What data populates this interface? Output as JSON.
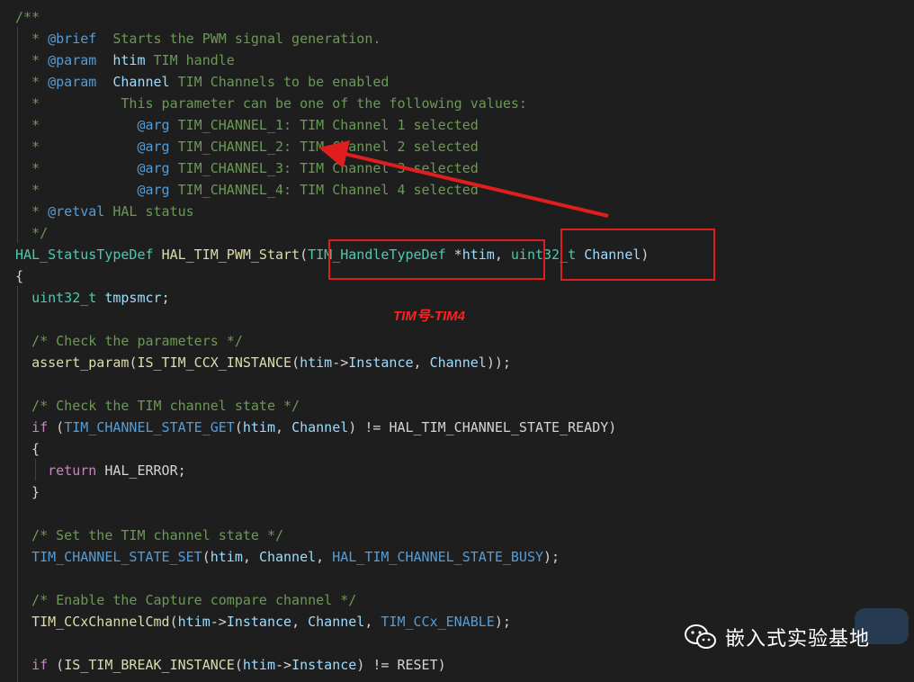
{
  "colors": {
    "background": "#1e1e1e",
    "comment": "#6a9955",
    "doc_keyword": "#569cd6",
    "plain": "#d4d4d4",
    "function": "#dcdcaa",
    "type": "#4ec9b0",
    "variable": "#9cdcfe",
    "macro": "#4fc1ff",
    "control_keyword": "#c586c0",
    "annotation_red": "#e01e1e"
  },
  "code_lines": [
    [
      {
        "t": "/**",
        "c": "c"
      }
    ],
    [
      {
        "t": "  * ",
        "c": "c"
      },
      {
        "t": "@brief",
        "c": "dk"
      },
      {
        "t": "  Starts the PWM signal generation.",
        "c": "c"
      }
    ],
    [
      {
        "t": "  * ",
        "c": "c"
      },
      {
        "t": "@param",
        "c": "dk"
      },
      {
        "t": "  ",
        "c": "c"
      },
      {
        "t": "htim",
        "c": "v"
      },
      {
        "t": " TIM handle",
        "c": "c"
      }
    ],
    [
      {
        "t": "  * ",
        "c": "c"
      },
      {
        "t": "@param",
        "c": "dk"
      },
      {
        "t": "  ",
        "c": "c"
      },
      {
        "t": "Channel",
        "c": "v"
      },
      {
        "t": " TIM Channels to be enabled",
        "c": "c"
      }
    ],
    [
      {
        "t": "  *          This parameter can be one of the following values:",
        "c": "c"
      }
    ],
    [
      {
        "t": "  *            ",
        "c": "c"
      },
      {
        "t": "@arg",
        "c": "dk"
      },
      {
        "t": " TIM_CHANNEL_1: TIM Channel 1 selected",
        "c": "c"
      }
    ],
    [
      {
        "t": "  *            ",
        "c": "c"
      },
      {
        "t": "@arg",
        "c": "dk"
      },
      {
        "t": " TIM_CHANNEL_2: TIM Channel 2 selected",
        "c": "c"
      }
    ],
    [
      {
        "t": "  *            ",
        "c": "c"
      },
      {
        "t": "@arg",
        "c": "dk"
      },
      {
        "t": " TIM_CHANNEL_3: TIM Channel 3 selected",
        "c": "c"
      }
    ],
    [
      {
        "t": "  *            ",
        "c": "c"
      },
      {
        "t": "@arg",
        "c": "dk"
      },
      {
        "t": " TIM_CHANNEL_4: TIM Channel 4 selected",
        "c": "c"
      }
    ],
    [
      {
        "t": "  * ",
        "c": "c"
      },
      {
        "t": "@retval",
        "c": "dk"
      },
      {
        "t": " HAL status",
        "c": "c"
      }
    ],
    [
      {
        "t": "  */",
        "c": "c"
      }
    ],
    [
      {
        "t": "HAL_StatusTypeDef",
        "c": "t"
      },
      {
        "t": " ",
        "c": "p"
      },
      {
        "t": "HAL_TIM_PWM_Start",
        "c": "f"
      },
      {
        "t": "(",
        "c": "p"
      },
      {
        "t": "TIM_HandleTypeDef",
        "c": "t"
      },
      {
        "t": " *",
        "c": "p"
      },
      {
        "t": "htim",
        "c": "v"
      },
      {
        "t": ", ",
        "c": "p"
      },
      {
        "t": "uint32_t",
        "c": "t"
      },
      {
        "t": " ",
        "c": "p"
      },
      {
        "t": "Channel",
        "c": "v"
      },
      {
        "t": ")",
        "c": "p"
      }
    ],
    [
      {
        "t": "{",
        "c": "p"
      }
    ],
    [
      {
        "t": "  ",
        "c": "p"
      },
      {
        "t": "uint32_t",
        "c": "t"
      },
      {
        "t": " ",
        "c": "p"
      },
      {
        "t": "tmpsmcr",
        "c": "v"
      },
      {
        "t": ";",
        "c": "p"
      }
    ],
    [],
    [
      {
        "t": "  /* Check the parameters */",
        "c": "c"
      }
    ],
    [
      {
        "t": "  ",
        "c": "p"
      },
      {
        "t": "assert_param",
        "c": "f"
      },
      {
        "t": "(",
        "c": "p"
      },
      {
        "t": "IS_TIM_CCX_INSTANCE",
        "c": "f"
      },
      {
        "t": "(",
        "c": "p"
      },
      {
        "t": "htim",
        "c": "v"
      },
      {
        "t": "->",
        "c": "p"
      },
      {
        "t": "Instance",
        "c": "v"
      },
      {
        "t": ", ",
        "c": "p"
      },
      {
        "t": "Channel",
        "c": "v"
      },
      {
        "t": "));",
        "c": "p"
      }
    ],
    [],
    [
      {
        "t": "  /* Check the TIM channel state */",
        "c": "c"
      }
    ],
    [
      {
        "t": "  ",
        "c": "p"
      },
      {
        "t": "if",
        "c": "k"
      },
      {
        "t": " (",
        "c": "p"
      },
      {
        "t": "TIM_CHANNEL_STATE_GET",
        "c": "dk"
      },
      {
        "t": "(",
        "c": "p"
      },
      {
        "t": "htim",
        "c": "v"
      },
      {
        "t": ", ",
        "c": "p"
      },
      {
        "t": "Channel",
        "c": "v"
      },
      {
        "t": ") != ",
        "c": "p"
      },
      {
        "t": "HAL_TIM_CHANNEL_STATE_READY",
        "c": "p"
      },
      {
        "t": ")",
        "c": "p"
      }
    ],
    [
      {
        "t": "  {",
        "c": "p"
      }
    ],
    [
      {
        "t": "    ",
        "c": "p"
      },
      {
        "t": "return",
        "c": "k"
      },
      {
        "t": " ",
        "c": "p"
      },
      {
        "t": "HAL_ERROR",
        "c": "p"
      },
      {
        "t": ";",
        "c": "p"
      }
    ],
    [
      {
        "t": "  }",
        "c": "p"
      }
    ],
    [],
    [
      {
        "t": "  /* Set the TIM channel state */",
        "c": "c"
      }
    ],
    [
      {
        "t": "  ",
        "c": "p"
      },
      {
        "t": "TIM_CHANNEL_STATE_SET",
        "c": "dk"
      },
      {
        "t": "(",
        "c": "p"
      },
      {
        "t": "htim",
        "c": "v"
      },
      {
        "t": ", ",
        "c": "p"
      },
      {
        "t": "Channel",
        "c": "v"
      },
      {
        "t": ", ",
        "c": "p"
      },
      {
        "t": "HAL_TIM_CHANNEL_STATE_BUSY",
        "c": "dk"
      },
      {
        "t": ");",
        "c": "p"
      }
    ],
    [],
    [
      {
        "t": "  /* Enable the Capture compare channel */",
        "c": "c"
      }
    ],
    [
      {
        "t": "  ",
        "c": "p"
      },
      {
        "t": "TIM_CCxChannelCmd",
        "c": "f"
      },
      {
        "t": "(",
        "c": "p"
      },
      {
        "t": "htim",
        "c": "v"
      },
      {
        "t": "->",
        "c": "p"
      },
      {
        "t": "Instance",
        "c": "v"
      },
      {
        "t": ", ",
        "c": "p"
      },
      {
        "t": "Channel",
        "c": "v"
      },
      {
        "t": ", ",
        "c": "p"
      },
      {
        "t": "TIM_CCx_ENABLE",
        "c": "dk"
      },
      {
        "t": ");",
        "c": "p"
      }
    ],
    [],
    [
      {
        "t": "  ",
        "c": "p"
      },
      {
        "t": "if",
        "c": "k"
      },
      {
        "t": " (",
        "c": "p"
      },
      {
        "t": "IS_TIM_BREAK_INSTANCE",
        "c": "f"
      },
      {
        "t": "(",
        "c": "p"
      },
      {
        "t": "htim",
        "c": "v"
      },
      {
        "t": "->",
        "c": "p"
      },
      {
        "t": "Instance",
        "c": "v"
      },
      {
        "t": ") != ",
        "c": "p"
      },
      {
        "t": "RESET",
        "c": "p"
      },
      {
        "t": ")",
        "c": "p"
      }
    ]
  ],
  "annotation": {
    "note": "TIM号-TIM4"
  },
  "watermark": {
    "text": "嵌入式实验基地",
    "icon": "wechat-icon"
  }
}
